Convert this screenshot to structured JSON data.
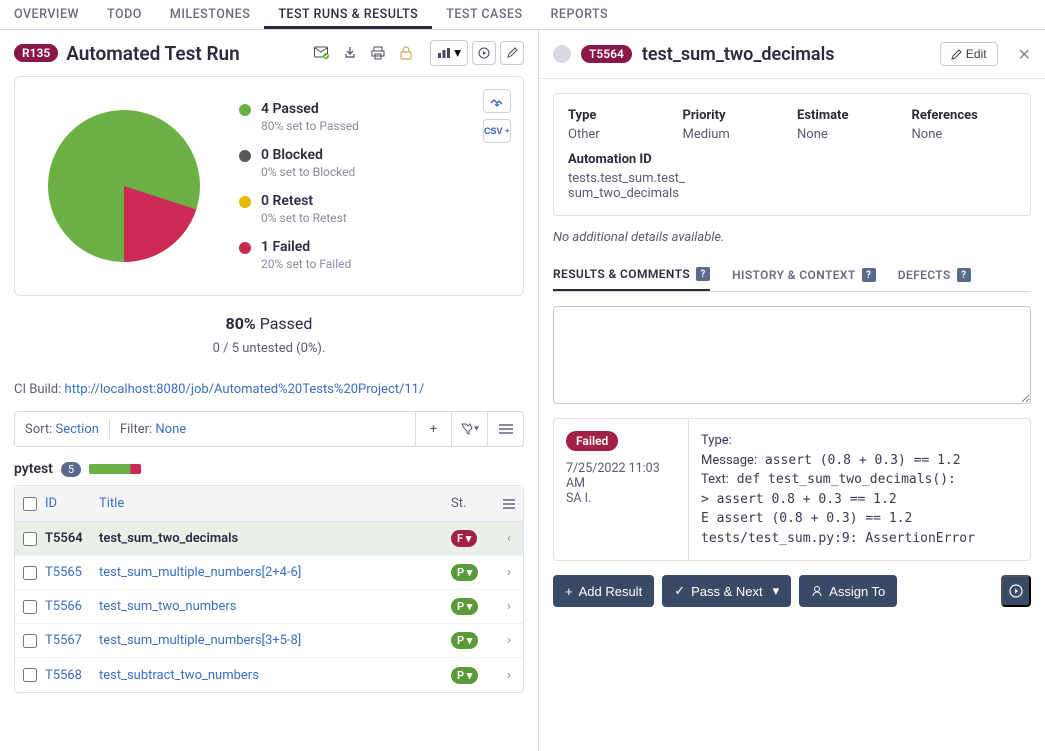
{
  "nav": {
    "items": [
      "OVERVIEW",
      "TODO",
      "MILESTONES",
      "TEST RUNS & RESULTS",
      "TEST CASES",
      "REPORTS"
    ],
    "active_index": 3
  },
  "run": {
    "badge": "R135",
    "title": "Automated Test Run"
  },
  "chart_data": {
    "type": "pie",
    "title": "",
    "series": [
      {
        "name": "Passed",
        "count": 4,
        "pct": 80,
        "sub": "80% set to Passed",
        "color": "#6bb045"
      },
      {
        "name": "Blocked",
        "count": 0,
        "pct": 0,
        "sub": "0% set to Blocked",
        "color": "#5a5a5a"
      },
      {
        "name": "Retest",
        "count": 0,
        "pct": 0,
        "sub": "0% set to Retest",
        "color": "#e6b800"
      },
      {
        "name": "Failed",
        "count": 1,
        "pct": 20,
        "sub": "20% set to Failed",
        "color": "#cc2a55"
      }
    ]
  },
  "summary": {
    "pct": "80%",
    "pct_label": "Passed",
    "sub": "0 / 5 untested (0%)."
  },
  "ci": {
    "label": "CI Build:",
    "url": "http://localhost:8080/job/Automated%20Tests%20Project/11/"
  },
  "filterbar": {
    "sort_label": "Sort:",
    "sort_value": "Section",
    "filter_label": "Filter:",
    "filter_value": "None"
  },
  "section": {
    "name": "pytest",
    "count": "5",
    "pass_pct": 80
  },
  "table": {
    "headers": {
      "id": "ID",
      "title": "Title",
      "st": "St."
    },
    "rows": [
      {
        "id": "T5564",
        "title": "test_sum_two_decimals",
        "status": "F",
        "status_type": "fail",
        "selected": true
      },
      {
        "id": "T5565",
        "title": "test_sum_multiple_numbers[2+4-6]",
        "status": "P",
        "status_type": "pass",
        "selected": false
      },
      {
        "id": "T5566",
        "title": "test_sum_two_numbers",
        "status": "P",
        "status_type": "pass",
        "selected": false
      },
      {
        "id": "T5567",
        "title": "test_sum_multiple_numbers[3+5-8]",
        "status": "P",
        "status_type": "pass",
        "selected": false
      },
      {
        "id": "T5568",
        "title": "test_subtract_two_numbers",
        "status": "P",
        "status_type": "pass",
        "selected": false
      }
    ]
  },
  "detail": {
    "badge": "T5564",
    "title": "test_sum_two_decimals",
    "edit_label": "Edit",
    "fields": {
      "type_label": "Type",
      "type_value": "Other",
      "priority_label": "Priority",
      "priority_value": "Medium",
      "estimate_label": "Estimate",
      "estimate_value": "None",
      "references_label": "References",
      "references_value": "None",
      "automation_label": "Automation ID",
      "automation_value": "tests.test_sum.test_sum_two_decimals"
    },
    "no_details": "No additional details available."
  },
  "inner_tabs": {
    "items": [
      "RESULTS & COMMENTS",
      "HISTORY & CONTEXT",
      "DEFECTS"
    ],
    "active_index": 0
  },
  "result": {
    "status": "Failed",
    "timestamp": "7/25/2022 11:03 AM",
    "author": "SA I.",
    "type_label": "Type:",
    "type_value": "",
    "message_label": "Message:",
    "message_value": "assert (0.8 + 0.3) == 1.2",
    "text_label": "Text:",
    "text_lines": [
      "def test_sum_two_decimals():",
      ">       assert 0.8 + 0.3 == 1.2",
      "E       assert (0.8 + 0.3) == 1.2",
      "",
      "tests/test_sum.py:9: AssertionError"
    ]
  },
  "actions": {
    "add_result": "Add Result",
    "pass_next": "Pass & Next",
    "assign_to": "Assign To"
  },
  "export": {
    "csv": "CSV"
  }
}
